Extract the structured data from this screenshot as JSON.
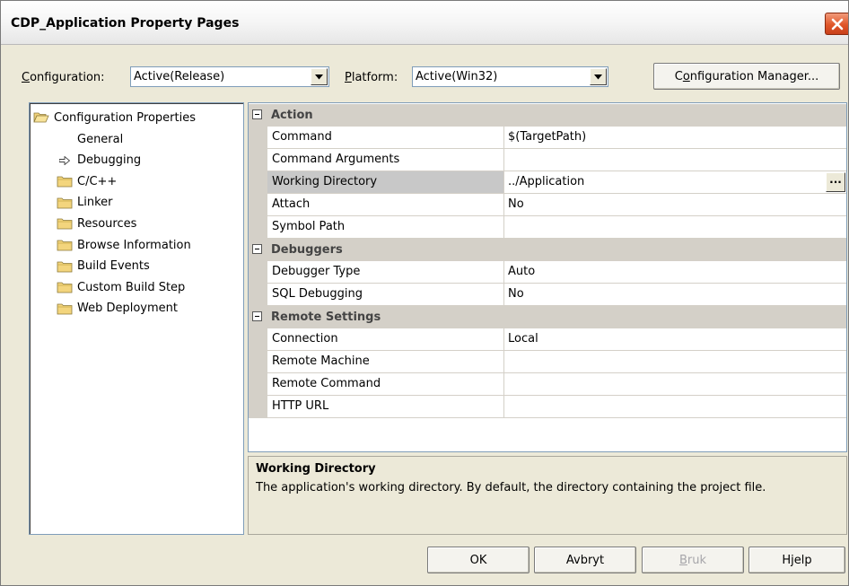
{
  "window": {
    "title": "CDP_Application Property Pages"
  },
  "config": {
    "configuration_label_underlined": "C",
    "configuration_label_rest": "onfiguration:",
    "configuration_value": "Active(Release)",
    "platform_label_underlined": "P",
    "platform_label_rest": "latform:",
    "platform_value": "Active(Win32)",
    "manager_underlined": "o",
    "manager_before": "C",
    "manager_after": "nfiguration Manager..."
  },
  "tree": {
    "root": "Configuration Properties",
    "items": [
      {
        "label": "General",
        "icon": "none"
      },
      {
        "label": "Debugging",
        "icon": "arrow-right-icon"
      },
      {
        "label": "C/C++",
        "icon": "folder-icon"
      },
      {
        "label": "Linker",
        "icon": "folder-icon"
      },
      {
        "label": "Resources",
        "icon": "folder-icon"
      },
      {
        "label": "Browse Information",
        "icon": "folder-icon"
      },
      {
        "label": "Build Events",
        "icon": "folder-icon"
      },
      {
        "label": "Custom Build Step",
        "icon": "folder-icon"
      },
      {
        "label": "Web Deployment",
        "icon": "folder-icon"
      }
    ]
  },
  "grid": {
    "categories": [
      {
        "name": "Action",
        "props": [
          {
            "name": "Command",
            "value": "$(TargetPath)"
          },
          {
            "name": "Command Arguments",
            "value": ""
          },
          {
            "name": "Working Directory",
            "value": "../Application",
            "selected": true
          },
          {
            "name": "Attach",
            "value": "No"
          },
          {
            "name": "Symbol Path",
            "value": ""
          }
        ]
      },
      {
        "name": "Debuggers",
        "props": [
          {
            "name": "Debugger Type",
            "value": "Auto"
          },
          {
            "name": "SQL Debugging",
            "value": "No"
          }
        ]
      },
      {
        "name": "Remote Settings",
        "props": [
          {
            "name": "Connection",
            "value": "Local"
          },
          {
            "name": "Remote Machine",
            "value": ""
          },
          {
            "name": "Remote Command",
            "value": ""
          },
          {
            "name": "HTTP URL",
            "value": ""
          }
        ]
      }
    ],
    "ellipsis": "..."
  },
  "description": {
    "title": "Working Directory",
    "text": "The application's working directory.  By default, the directory containing the project file."
  },
  "buttons": {
    "ok": "OK",
    "cancel": "Avbryt",
    "apply_underlined": "B",
    "apply_rest": "ruk",
    "help": "Hjelp"
  },
  "colors": {
    "close_button": "#e0572a",
    "category_bg": "#d4d0c8",
    "selection_bg": "#c8c8c8"
  }
}
